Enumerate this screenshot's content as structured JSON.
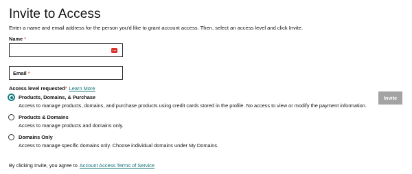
{
  "page": {
    "title": "Invite to Access",
    "intro": "Enter a name and email address for the person you'd like to grant account access. Then, select an access level and click Invite."
  },
  "form": {
    "name": {
      "label": "Name",
      "required_mark": "*",
      "value": "",
      "autofill_icon": "password-manager-icon"
    },
    "email": {
      "label": "Email",
      "required_mark": "*",
      "value": ""
    },
    "access_level": {
      "label": "Access level requested",
      "required_mark": "*",
      "learn_more": "Learn More",
      "selected": "products-domains-purchase",
      "options": [
        {
          "id": "products-domains-purchase",
          "title": "Products, Domains, & Purchase",
          "description": "Access to manage products, domains, and purchase products using credit cards stored in the profile. No access to view or modify the payment information."
        },
        {
          "id": "products-domains",
          "title": "Products & Domains",
          "description": "Access to manage products and domains only."
        },
        {
          "id": "domains-only",
          "title": "Domains Only",
          "description": "Access to manage specific domains only. Choose individual domains under My Domains."
        }
      ]
    },
    "invite_button": {
      "label": "Invite",
      "disabled": true
    }
  },
  "terms": {
    "text": "By clicking Invite, you agree to",
    "link": "Account Access Terms of Service"
  },
  "colors": {
    "link": "#0f6f72",
    "required": "#db1802",
    "button_disabled": "#a3a3a3",
    "autofill_icon": "#d9342b"
  }
}
